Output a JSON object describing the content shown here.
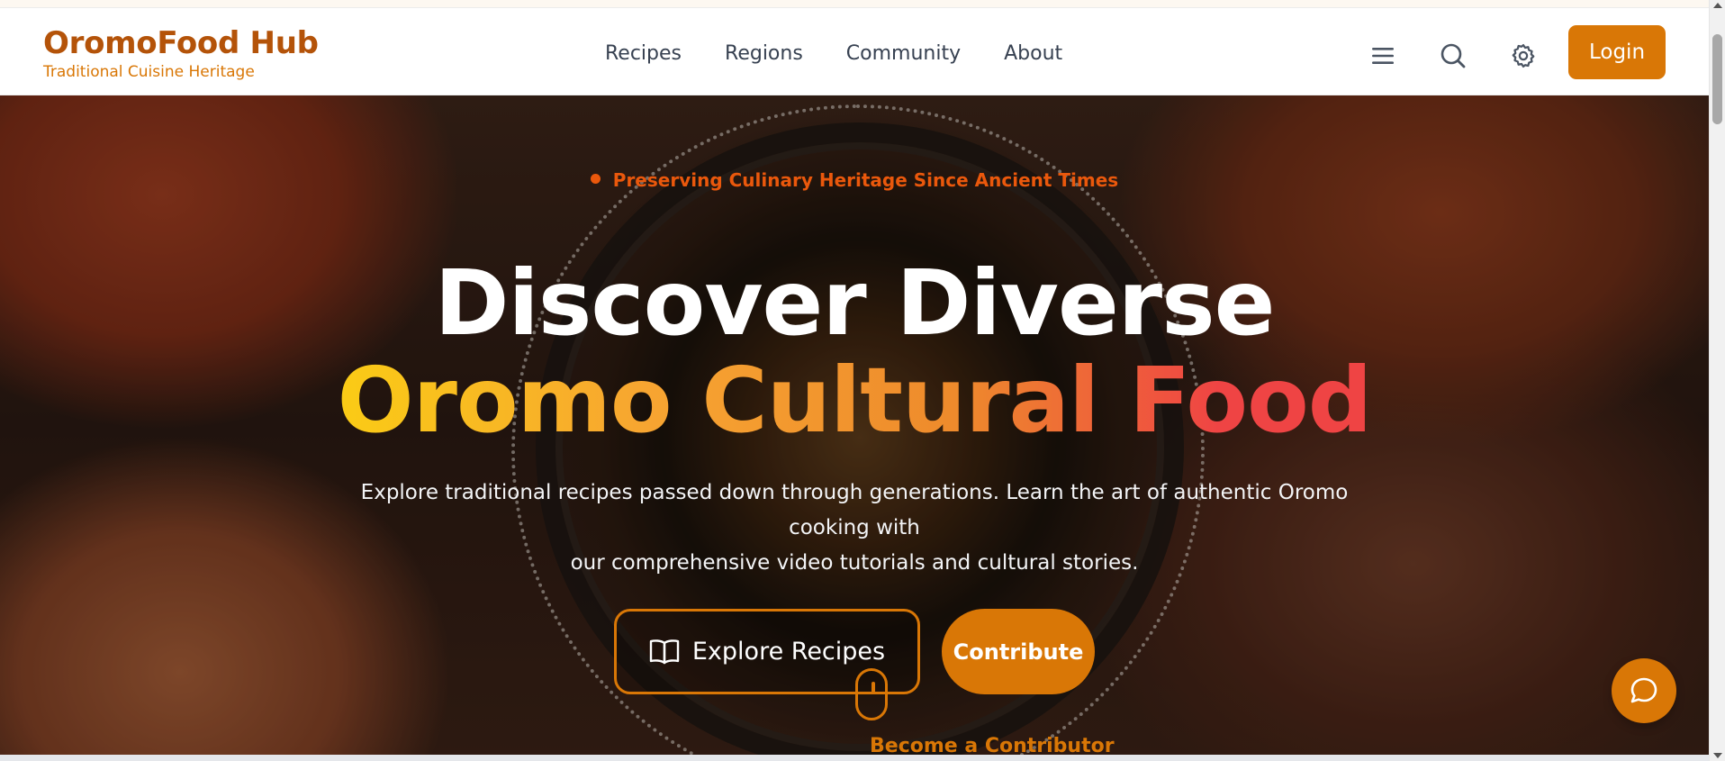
{
  "brand": {
    "title": "OromoFood Hub",
    "subtitle": "Traditional Cuisine Heritage"
  },
  "nav": {
    "links": [
      {
        "label": "Recipes"
      },
      {
        "label": "Regions"
      },
      {
        "label": "Community"
      },
      {
        "label": "About"
      }
    ],
    "login_label": "Login"
  },
  "icons": {
    "menu": "menu-icon",
    "search": "search-icon",
    "settings": "gear-icon",
    "book": "book-open-icon",
    "chat": "chat-bubble-icon",
    "mouse": "scroll-mouse-icon"
  },
  "hero": {
    "tagline": "Preserving Culinary Heritage Since Ancient Times",
    "title_line1": "Discover Diverse",
    "title_line2": "Oromo Cultural Food",
    "description_line1": "Explore traditional recipes passed down through generations. Learn the art of authentic Oromo cooking with",
    "description_line2": "our comprehensive video tutorials and cultural stories.",
    "explore_label": "Explore Recipes",
    "contribute_label": "Contribute",
    "become_label": "Become a Contributor"
  },
  "colors": {
    "brand": "#b45309",
    "accent": "#d97706",
    "tagline": "#ea580c",
    "gradient_start": "#facc15",
    "gradient_end": "#ef4444"
  }
}
